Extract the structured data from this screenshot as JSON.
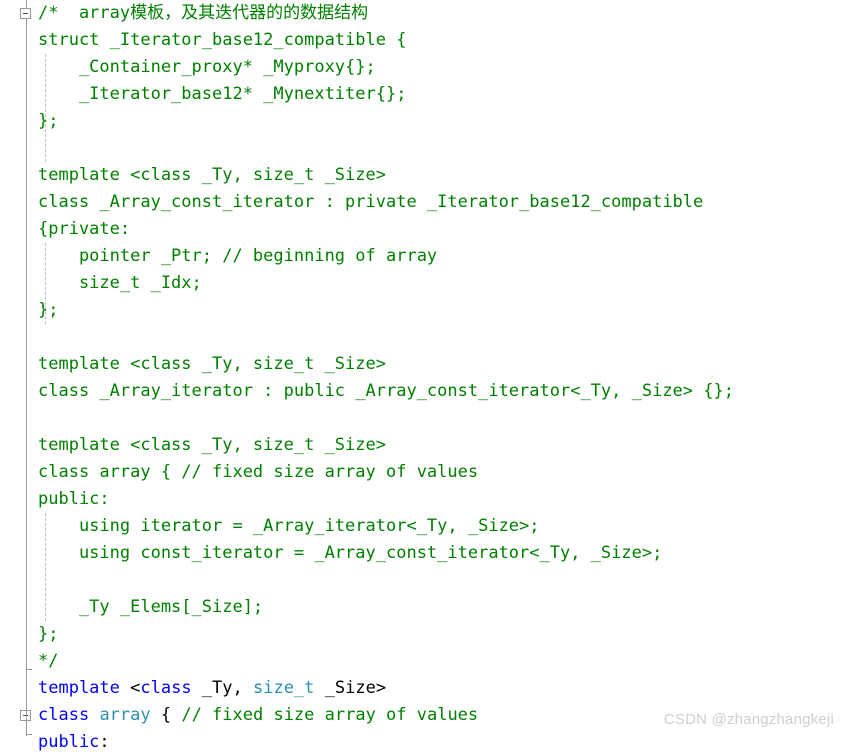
{
  "editor": {
    "background": "#ffffff",
    "font_size_px": 17,
    "line_height_px": 27,
    "colors": {
      "comment": "#008000",
      "keyword": "#0000ff",
      "type": "#2b91af",
      "plain": "#000000",
      "gutter_line": "#9a9a9a",
      "indent_guide": "#bfbfbf",
      "watermark": "#cfcfcf"
    }
  },
  "gutter": {
    "collapse_markers": [
      {
        "name": "collapse-comment-block",
        "state": "expanded",
        "glyph": "minus"
      },
      {
        "name": "collapse-class-array",
        "state": "expanded",
        "glyph": "minus"
      }
    ]
  },
  "code": {
    "lines": [
      {
        "n": 1,
        "segments": [
          {
            "t": "/*  array模板，及其迭代器的的数据结构",
            "c": "cmt"
          }
        ]
      },
      {
        "n": 2,
        "segments": [
          {
            "t": "struct _Iterator_base12_compatible {",
            "c": "cmt"
          }
        ]
      },
      {
        "n": 3,
        "segments": [
          {
            "t": "    _Container_proxy* _Myproxy{};",
            "c": "cmt"
          }
        ]
      },
      {
        "n": 4,
        "segments": [
          {
            "t": "    _Iterator_base12* _Mynextiter{};",
            "c": "cmt"
          }
        ]
      },
      {
        "n": 5,
        "segments": [
          {
            "t": "};",
            "c": "cmt"
          }
        ]
      },
      {
        "n": 6,
        "segments": [
          {
            "t": "",
            "c": "cmt"
          }
        ]
      },
      {
        "n": 7,
        "segments": [
          {
            "t": "template <class _Ty, size_t _Size>",
            "c": "cmt"
          }
        ]
      },
      {
        "n": 8,
        "segments": [
          {
            "t": "class _Array_const_iterator : private _Iterator_base12_compatible",
            "c": "cmt"
          }
        ]
      },
      {
        "n": 9,
        "segments": [
          {
            "t": "{private:",
            "c": "cmt"
          }
        ]
      },
      {
        "n": 10,
        "segments": [
          {
            "t": "    pointer _Ptr; // beginning of array",
            "c": "cmt"
          }
        ]
      },
      {
        "n": 11,
        "segments": [
          {
            "t": "    size_t _Idx;",
            "c": "cmt"
          }
        ]
      },
      {
        "n": 12,
        "segments": [
          {
            "t": "};",
            "c": "cmt"
          }
        ]
      },
      {
        "n": 13,
        "segments": [
          {
            "t": "",
            "c": "cmt"
          }
        ]
      },
      {
        "n": 14,
        "segments": [
          {
            "t": "template <class _Ty, size_t _Size>",
            "c": "cmt"
          }
        ]
      },
      {
        "n": 15,
        "segments": [
          {
            "t": "class _Array_iterator : public _Array_const_iterator<_Ty, _Size> {};",
            "c": "cmt"
          }
        ]
      },
      {
        "n": 16,
        "segments": [
          {
            "t": "",
            "c": "cmt"
          }
        ]
      },
      {
        "n": 17,
        "segments": [
          {
            "t": "template <class _Ty, size_t _Size>",
            "c": "cmt"
          }
        ]
      },
      {
        "n": 18,
        "segments": [
          {
            "t": "class array { // fixed size array of values",
            "c": "cmt"
          }
        ]
      },
      {
        "n": 19,
        "segments": [
          {
            "t": "public:",
            "c": "cmt"
          }
        ]
      },
      {
        "n": 20,
        "segments": [
          {
            "t": "    using iterator = _Array_iterator<_Ty, _Size>;",
            "c": "cmt"
          }
        ]
      },
      {
        "n": 21,
        "segments": [
          {
            "t": "    using const_iterator = _Array_const_iterator<_Ty, _Size>;",
            "c": "cmt"
          }
        ]
      },
      {
        "n": 22,
        "segments": [
          {
            "t": "",
            "c": "cmt"
          }
        ]
      },
      {
        "n": 23,
        "segments": [
          {
            "t": "    _Ty _Elems[_Size];",
            "c": "cmt"
          }
        ]
      },
      {
        "n": 24,
        "segments": [
          {
            "t": "};",
            "c": "cmt"
          }
        ]
      },
      {
        "n": 25,
        "segments": [
          {
            "t": "*/",
            "c": "cmt"
          }
        ]
      },
      {
        "n": 26,
        "segments": [
          {
            "t": "template",
            "c": "kw"
          },
          {
            "t": " <",
            "c": "pln"
          },
          {
            "t": "class",
            "c": "kw"
          },
          {
            "t": " _Ty, ",
            "c": "pln"
          },
          {
            "t": "size_t",
            "c": "typ"
          },
          {
            "t": " _Size>",
            "c": "pln"
          }
        ]
      },
      {
        "n": 27,
        "segments": [
          {
            "t": "class",
            "c": "kw"
          },
          {
            "t": " ",
            "c": "pln"
          },
          {
            "t": "array",
            "c": "typ"
          },
          {
            "t": " { ",
            "c": "pln"
          },
          {
            "t": "// fixed size array of values",
            "c": "cmt"
          }
        ]
      },
      {
        "n": 28,
        "segments": [
          {
            "t": "public",
            "c": "kw"
          },
          {
            "t": ":",
            "c": "pln"
          }
        ]
      }
    ]
  },
  "watermark": {
    "text": "CSDN @zhangzhangkeji"
  }
}
